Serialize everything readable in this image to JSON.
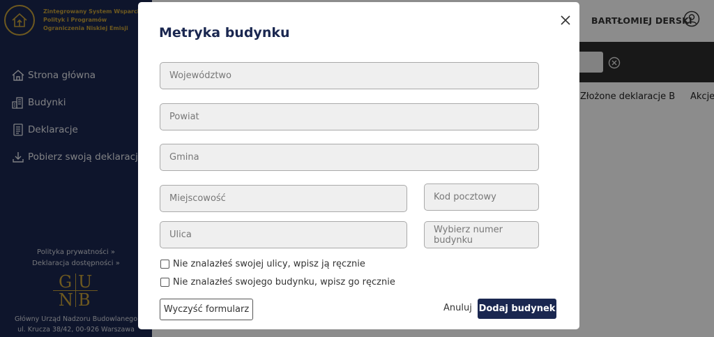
{
  "sidebar": {
    "logo_lines": [
      "Zintegrowany System Wsparcia",
      "Polityk i Programów",
      "Ograniczenia Niskiej Emisji"
    ],
    "items": [
      {
        "label": "Strona główna",
        "icon": "home-icon"
      },
      {
        "label": "Budynki",
        "icon": "buildings-icon"
      },
      {
        "label": "Deklaracje",
        "icon": "document-icon"
      },
      {
        "label": "Pobierz swoją deklarację",
        "icon": "download-icon"
      }
    ],
    "privacy_link": "Polityka prywatności »",
    "accessibility_link": "Deklaracja dostępności »",
    "gunb_letters": [
      "G",
      "U",
      "N",
      "B"
    ],
    "org_name": "Główny Urząd Nadzoru Budowlanego",
    "org_address": "ul. Krucza 38/42, 00-926 Warszawa"
  },
  "header": {
    "user_name": "BARTŁOMIEJ DERSKI"
  },
  "table": {
    "columns": [
      "Złożone deklaracje B",
      "Akcje"
    ]
  },
  "modal": {
    "title": "Metryka budynku",
    "fields": {
      "wojewodztwo": "Województwo",
      "powiat": "Powiat",
      "gmina": "Gmina",
      "miejscowosc": "Miejscowość",
      "kod_pocztowy": "Kod pocztowy",
      "ulica": "Ulica",
      "numer_budynku": "Wybierz numer budynku"
    },
    "checkboxes": {
      "street_manual": "Nie znalazłeś swojej ulicy, wpisz ją ręcznie",
      "building_manual": "Nie znalazłeś swojego budynku, wpisz go ręcznie"
    },
    "buttons": {
      "clear": "Wyczyść formularz",
      "cancel": "Anuluj",
      "add": "Dodaj budynek"
    }
  },
  "colors": {
    "navy": "#1a2750",
    "gold": "#c9a23a"
  }
}
